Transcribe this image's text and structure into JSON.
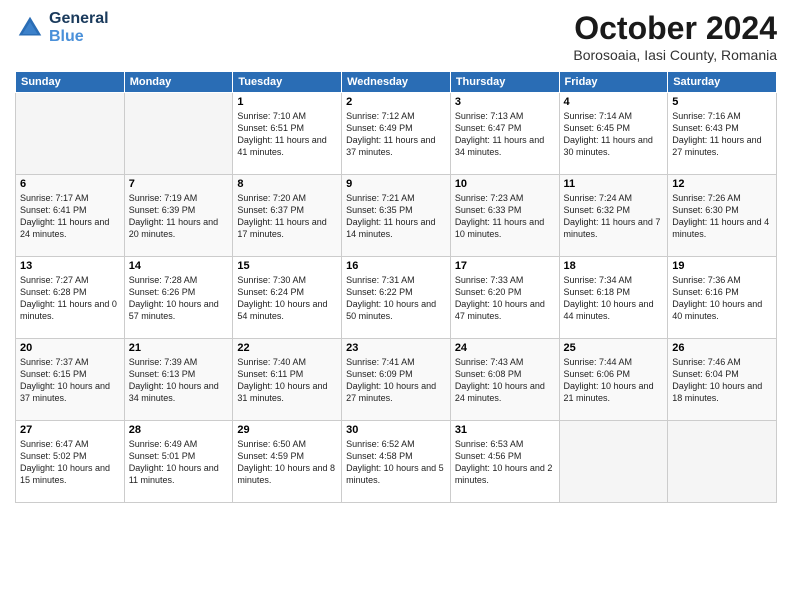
{
  "header": {
    "logo_line1": "General",
    "logo_line2": "Blue",
    "month": "October 2024",
    "location": "Borosoaia, Iasi County, Romania"
  },
  "weekdays": [
    "Sunday",
    "Monday",
    "Tuesday",
    "Wednesday",
    "Thursday",
    "Friday",
    "Saturday"
  ],
  "weeks": [
    [
      {
        "day": "",
        "detail": ""
      },
      {
        "day": "",
        "detail": ""
      },
      {
        "day": "1",
        "detail": "Sunrise: 7:10 AM\nSunset: 6:51 PM\nDaylight: 11 hours and 41 minutes."
      },
      {
        "day": "2",
        "detail": "Sunrise: 7:12 AM\nSunset: 6:49 PM\nDaylight: 11 hours and 37 minutes."
      },
      {
        "day": "3",
        "detail": "Sunrise: 7:13 AM\nSunset: 6:47 PM\nDaylight: 11 hours and 34 minutes."
      },
      {
        "day": "4",
        "detail": "Sunrise: 7:14 AM\nSunset: 6:45 PM\nDaylight: 11 hours and 30 minutes."
      },
      {
        "day": "5",
        "detail": "Sunrise: 7:16 AM\nSunset: 6:43 PM\nDaylight: 11 hours and 27 minutes."
      }
    ],
    [
      {
        "day": "6",
        "detail": "Sunrise: 7:17 AM\nSunset: 6:41 PM\nDaylight: 11 hours and 24 minutes."
      },
      {
        "day": "7",
        "detail": "Sunrise: 7:19 AM\nSunset: 6:39 PM\nDaylight: 11 hours and 20 minutes."
      },
      {
        "day": "8",
        "detail": "Sunrise: 7:20 AM\nSunset: 6:37 PM\nDaylight: 11 hours and 17 minutes."
      },
      {
        "day": "9",
        "detail": "Sunrise: 7:21 AM\nSunset: 6:35 PM\nDaylight: 11 hours and 14 minutes."
      },
      {
        "day": "10",
        "detail": "Sunrise: 7:23 AM\nSunset: 6:33 PM\nDaylight: 11 hours and 10 minutes."
      },
      {
        "day": "11",
        "detail": "Sunrise: 7:24 AM\nSunset: 6:32 PM\nDaylight: 11 hours and 7 minutes."
      },
      {
        "day": "12",
        "detail": "Sunrise: 7:26 AM\nSunset: 6:30 PM\nDaylight: 11 hours and 4 minutes."
      }
    ],
    [
      {
        "day": "13",
        "detail": "Sunrise: 7:27 AM\nSunset: 6:28 PM\nDaylight: 11 hours and 0 minutes."
      },
      {
        "day": "14",
        "detail": "Sunrise: 7:28 AM\nSunset: 6:26 PM\nDaylight: 10 hours and 57 minutes."
      },
      {
        "day": "15",
        "detail": "Sunrise: 7:30 AM\nSunset: 6:24 PM\nDaylight: 10 hours and 54 minutes."
      },
      {
        "day": "16",
        "detail": "Sunrise: 7:31 AM\nSunset: 6:22 PM\nDaylight: 10 hours and 50 minutes."
      },
      {
        "day": "17",
        "detail": "Sunrise: 7:33 AM\nSunset: 6:20 PM\nDaylight: 10 hours and 47 minutes."
      },
      {
        "day": "18",
        "detail": "Sunrise: 7:34 AM\nSunset: 6:18 PM\nDaylight: 10 hours and 44 minutes."
      },
      {
        "day": "19",
        "detail": "Sunrise: 7:36 AM\nSunset: 6:16 PM\nDaylight: 10 hours and 40 minutes."
      }
    ],
    [
      {
        "day": "20",
        "detail": "Sunrise: 7:37 AM\nSunset: 6:15 PM\nDaylight: 10 hours and 37 minutes."
      },
      {
        "day": "21",
        "detail": "Sunrise: 7:39 AM\nSunset: 6:13 PM\nDaylight: 10 hours and 34 minutes."
      },
      {
        "day": "22",
        "detail": "Sunrise: 7:40 AM\nSunset: 6:11 PM\nDaylight: 10 hours and 31 minutes."
      },
      {
        "day": "23",
        "detail": "Sunrise: 7:41 AM\nSunset: 6:09 PM\nDaylight: 10 hours and 27 minutes."
      },
      {
        "day": "24",
        "detail": "Sunrise: 7:43 AM\nSunset: 6:08 PM\nDaylight: 10 hours and 24 minutes."
      },
      {
        "day": "25",
        "detail": "Sunrise: 7:44 AM\nSunset: 6:06 PM\nDaylight: 10 hours and 21 minutes."
      },
      {
        "day": "26",
        "detail": "Sunrise: 7:46 AM\nSunset: 6:04 PM\nDaylight: 10 hours and 18 minutes."
      }
    ],
    [
      {
        "day": "27",
        "detail": "Sunrise: 6:47 AM\nSunset: 5:02 PM\nDaylight: 10 hours and 15 minutes."
      },
      {
        "day": "28",
        "detail": "Sunrise: 6:49 AM\nSunset: 5:01 PM\nDaylight: 10 hours and 11 minutes."
      },
      {
        "day": "29",
        "detail": "Sunrise: 6:50 AM\nSunset: 4:59 PM\nDaylight: 10 hours and 8 minutes."
      },
      {
        "day": "30",
        "detail": "Sunrise: 6:52 AM\nSunset: 4:58 PM\nDaylight: 10 hours and 5 minutes."
      },
      {
        "day": "31",
        "detail": "Sunrise: 6:53 AM\nSunset: 4:56 PM\nDaylight: 10 hours and 2 minutes."
      },
      {
        "day": "",
        "detail": ""
      },
      {
        "day": "",
        "detail": ""
      }
    ]
  ]
}
